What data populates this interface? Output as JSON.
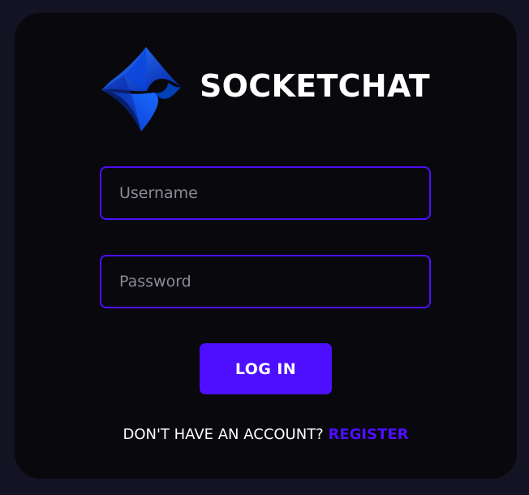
{
  "app": {
    "brand_name": "SOCKETCHAT",
    "logo_icon": "socketchat-logo",
    "colors": {
      "page_background": "#131324",
      "card_background": "#08080d",
      "accent": "#4e0eff",
      "text": "#ffffff",
      "placeholder": "#8b8b94"
    }
  },
  "form": {
    "username": {
      "value": "",
      "placeholder": "Username"
    },
    "password": {
      "value": "",
      "placeholder": "Password"
    },
    "submit_label": "LOG IN"
  },
  "register": {
    "prompt": "DON'T HAVE AN ACCOUNT?",
    "link_label": "REGISTER"
  }
}
